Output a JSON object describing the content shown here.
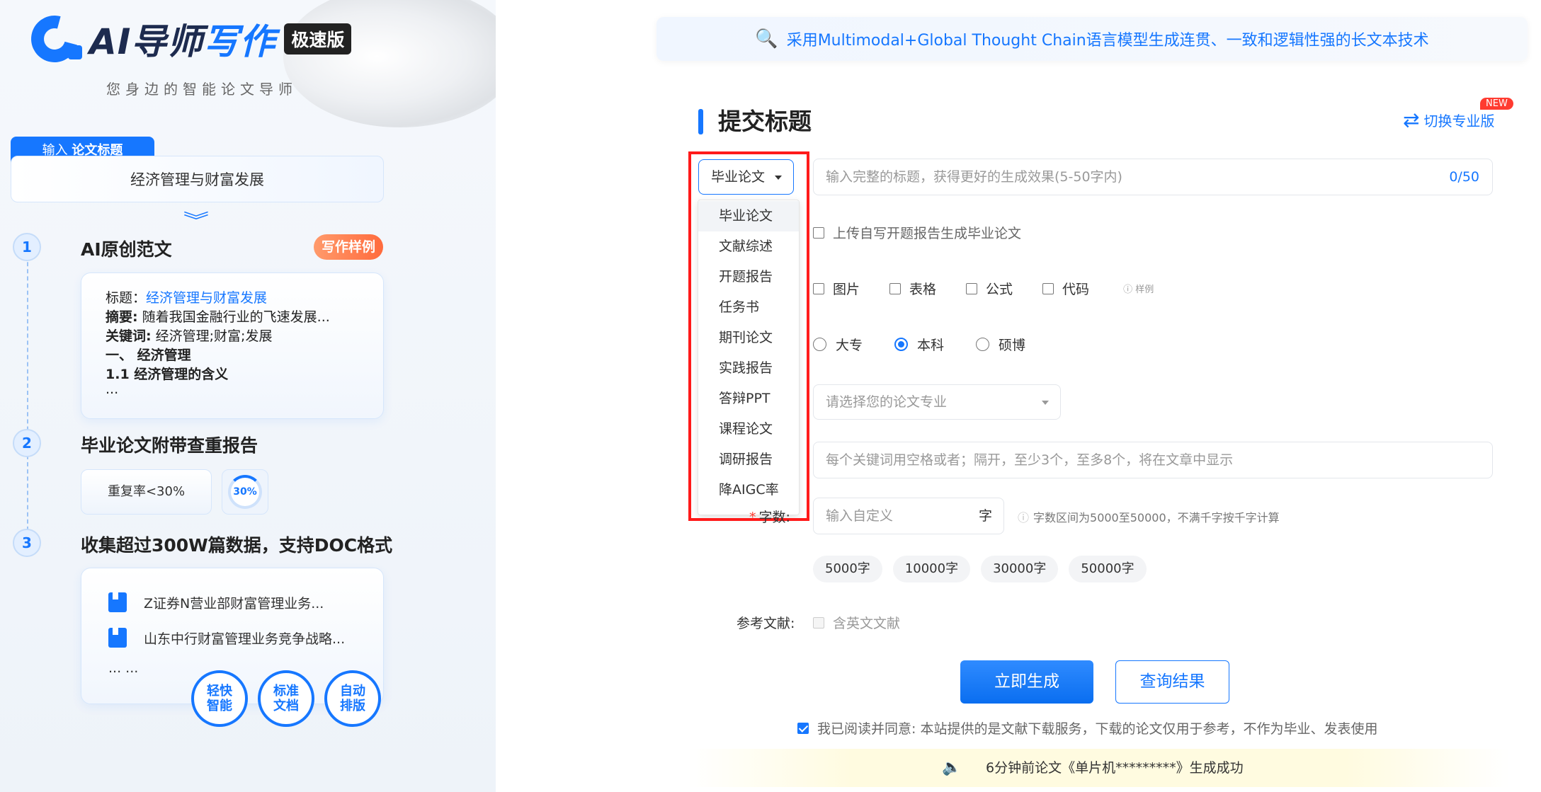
{
  "brand": {
    "logo_main": "AI导师",
    "logo_accent": "写作",
    "edition_badge": "极速版",
    "tagline": "您身边的智能论文导师"
  },
  "sidebar": {
    "input_tab_prefix": "输入",
    "input_tab_bold": "论文标题",
    "topic_value": "经济管理与财富发展",
    "steps": [
      {
        "num": "1",
        "title": "AI原创范文",
        "badge": "写作样例"
      },
      {
        "num": "2",
        "title": "毕业论文附带查重报告"
      },
      {
        "num": "3",
        "title": "收集超过300W篇数据，支持DOC格式"
      }
    ],
    "sample": {
      "title_label": "标题：",
      "title_value": "经济管理与财富发展",
      "abstract_label": "摘要:",
      "abstract_value": "随着我国金融行业的飞速发展...",
      "keywords_label": "关键词:",
      "keywords_value": "经济管理;财富;发展",
      "heading1": "一、 经济管理",
      "heading2": "1.1 经济管理的含义",
      "ellipsis": "..."
    },
    "dup_rate": "重复率<30%",
    "dup_circle": "30%",
    "refs": [
      "Z证券N营业部财富管理业务...",
      "山东中行财富管理业务竞争战略..."
    ],
    "refs_more": "... ...",
    "badges": [
      "轻快\n智能",
      "标准\n文档",
      "自动\n排版"
    ]
  },
  "main": {
    "banner": "采用Multimodal+Global Thought Chain语言模型生成连贯、一致和逻辑性强的长文本技术",
    "section_title": "提交标题",
    "switch_label": "切换专业版",
    "new_badge": "NEW",
    "type_select": "毕业论文",
    "type_options": [
      "毕业论文",
      "文献综述",
      "开题报告",
      "任务书",
      "期刊论文",
      "实践报告",
      "答辩PPT",
      "课程论文",
      "调研报告",
      "降AIGC率"
    ],
    "title_placeholder": "输入完整的标题，获得更好的生成效果(5-50字内)",
    "title_count": "0/50",
    "upload_label": "上传自写开题报告生成毕业论文",
    "options": [
      "图片",
      "表格",
      "公式",
      "代码"
    ],
    "options_hint": "ⓘ 样例",
    "levels": [
      "大专",
      "本科",
      "硕博"
    ],
    "level_selected": "本科",
    "major_placeholder": "请选择您的论文专业",
    "keywords_placeholder": "每个关键词用空格或者；隔开，至少3个，至多8个，将在文章中显示",
    "wordcount_label": "字数:",
    "wordcount_placeholder": "输入自定义",
    "wordcount_unit": "字",
    "wordcount_hint": "字数区间为5000至50000，不满千字按千字计算",
    "wordcount_chips": [
      "5000字",
      "10000字",
      "30000字",
      "50000字"
    ],
    "ref_label": "参考文献:",
    "ref_check": "含英文文献",
    "generate_btn": "立即生成",
    "query_btn": "查询结果",
    "agree_text": "我已阅读并同意: 本站提供的是文献下载服务，下载的论文仅用于参考，不作为毕业、发表使用",
    "notice": "6分钟前论文《单片机*********》生成成功"
  }
}
